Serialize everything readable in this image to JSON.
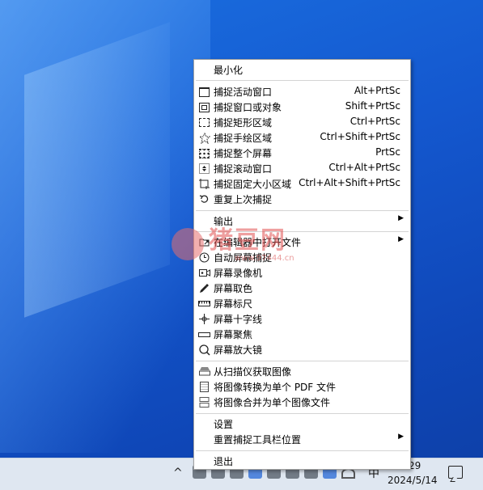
{
  "menu": {
    "minimize": "最小化",
    "capture": [
      {
        "icon": "active-window-icon",
        "label": "捕捉活动窗口",
        "accel": "Alt+PrtSc"
      },
      {
        "icon": "window-object-icon",
        "label": "捕捉窗口或对象",
        "accel": "Shift+PrtSc"
      },
      {
        "icon": "rectangle-region-icon",
        "label": "捕捉矩形区域",
        "accel": "Ctrl+PrtSc"
      },
      {
        "icon": "freehand-region-icon",
        "label": "捕捉手绘区域",
        "accel": "Ctrl+Shift+PrtSc"
      },
      {
        "icon": "full-screen-icon",
        "label": "捕捉整个屏幕",
        "accel": "PrtSc"
      },
      {
        "icon": "scrolling-window-icon",
        "label": "捕捉滚动窗口",
        "accel": "Ctrl+Alt+PrtSc"
      },
      {
        "icon": "fixed-size-region-icon",
        "label": "捕捉固定大小区域",
        "accel": "Ctrl+Alt+Shift+PrtSc"
      },
      {
        "icon": "repeat-capture-icon",
        "label": "重复上次捕捉",
        "accel": ""
      }
    ],
    "output": "输出",
    "tools": [
      {
        "icon": "open-folder-icon",
        "label": "在编辑器中打开文件"
      },
      {
        "icon": "auto-capture-icon",
        "label": "自动屏幕捕捉"
      },
      {
        "icon": "screen-recorder-icon",
        "label": "屏幕录像机"
      },
      {
        "icon": "color-picker-icon",
        "label": "屏幕取色"
      },
      {
        "icon": "ruler-icon",
        "label": "屏幕标尺"
      },
      {
        "icon": "crosshair-icon",
        "label": "屏幕十字线"
      },
      {
        "icon": "focus-bar-icon",
        "label": "屏幕聚焦"
      },
      {
        "icon": "magnifier-icon",
        "label": "屏幕放大镜"
      }
    ],
    "image": [
      {
        "icon": "scanner-icon",
        "label": "从扫描仪获取图像"
      },
      {
        "icon": "pdf-icon",
        "label": "将图像转换为单个 PDF 文件"
      },
      {
        "icon": "merge-images-icon",
        "label": "将图像合并为单个图像文件"
      }
    ],
    "settings": "设置",
    "reset_toolbar": "重置捕捉工具栏位置",
    "exit": "退出"
  },
  "taskbar": {
    "chevron": "^",
    "ime": "中",
    "time": "29",
    "date": "2024/5/14"
  },
  "watermark": {
    "text": "猪豆网",
    "url": "www.97444.cn"
  }
}
